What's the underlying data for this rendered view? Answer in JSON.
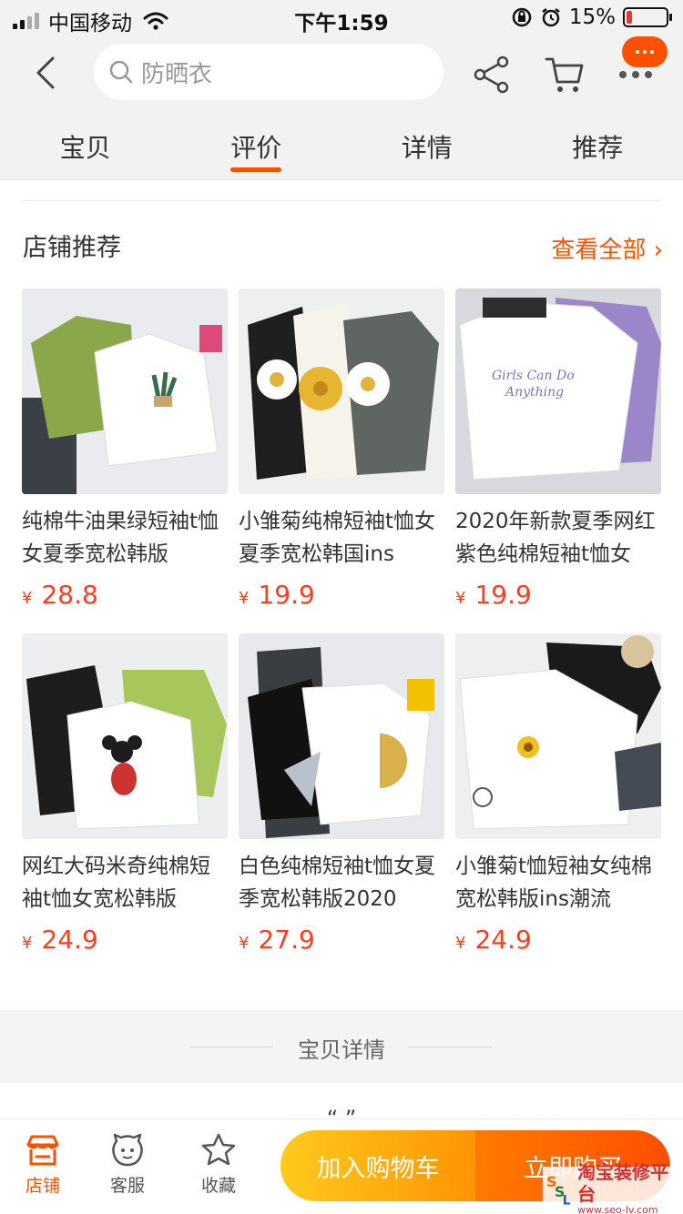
{
  "status_bar": {
    "carrier": "中国移动",
    "time": "下午1:59",
    "battery": "15%",
    "battery_level": 0.15
  },
  "nav": {
    "search_placeholder": "防晒衣",
    "icons": [
      "back-icon",
      "search-icon",
      "share-icon",
      "cart-icon",
      "more-icon",
      "message-icon"
    ]
  },
  "tabs": [
    {
      "label": "宝贝"
    },
    {
      "label": "评价",
      "active": true
    },
    {
      "label": "详情"
    },
    {
      "label": "推荐"
    }
  ],
  "shop_recommend": {
    "title": "店铺推荐",
    "see_all": "查看全部",
    "products": [
      {
        "title": "纯棉牛油果绿短袖t恤女夏季宽松韩版",
        "currency": "¥",
        "price": "28.8"
      },
      {
        "title": "小雏菊纯棉短袖t恤女夏季宽松韩国ins",
        "currency": "¥",
        "price": "19.9"
      },
      {
        "title": "2020年新款夏季网红紫色纯棉短袖t恤女",
        "currency": "¥",
        "price": "19.9"
      },
      {
        "title": "网红大码米奇纯棉短袖t恤女宽松韩版",
        "currency": "¥",
        "price": "24.9"
      },
      {
        "title": "白色纯棉短袖t恤女夏季宽松韩版2020",
        "currency": "¥",
        "price": "27.9"
      },
      {
        "title": "小雏菊t恤短袖女纯棉宽松韩版ins潮流",
        "currency": "¥",
        "price": "24.9"
      }
    ]
  },
  "detail": {
    "title": "宝贝详情"
  },
  "bottom_bar": {
    "shop": "店铺",
    "service": "客服",
    "favorite": "收藏",
    "add_to_cart": "加入购物车",
    "buy_now": "立即购买"
  },
  "watermark": {
    "name": "淘宝装修平台",
    "url": "www.seo-lv.com"
  },
  "colors": {
    "accent": "#ff5000",
    "price": "#ff3c1e",
    "cart_button": "#ff9402",
    "buy_button": "#ff4e00"
  }
}
